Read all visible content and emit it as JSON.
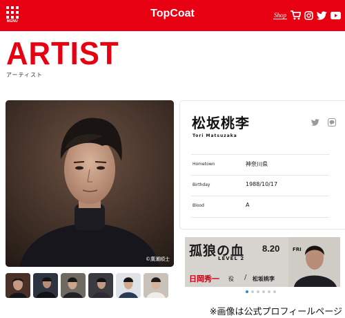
{
  "header": {
    "menu_label": "MENU",
    "brand": "TopCoat",
    "shop_logo_text": "Shop",
    "icons": [
      "shop-logo",
      "cart-icon",
      "instagram-icon",
      "twitter-icon",
      "youtube-icon"
    ]
  },
  "page": {
    "title": "ARTIST",
    "subtitle": "アーティスト"
  },
  "photo": {
    "credit": "©廣瀬順士"
  },
  "thumbnails": [
    "thumb-1",
    "thumb-2",
    "thumb-3",
    "thumb-4",
    "thumb-5",
    "thumb-6"
  ],
  "artist": {
    "name": "松坂桃李",
    "roman": "Tori Matsuzaka",
    "social": [
      "twitter-icon",
      "line-icon"
    ],
    "info": [
      {
        "label": "Hometown",
        "value": "神奈川県"
      },
      {
        "label": "Birthday",
        "value": "1988/10/17"
      },
      {
        "label": "Blood",
        "value": "A"
      }
    ]
  },
  "banner": {
    "title": "孤狼の血",
    "level": "LEVEL 2",
    "date": "8.20",
    "day": "FRI",
    "role": "日岡秀一",
    "role_suffix": "役",
    "slash": "/",
    "actor": "松坂桃李",
    "dots_total": 6,
    "dots_active": 1
  },
  "caption": "※画像は公式プロフィールページ",
  "colors": {
    "brand_red": "#e60012",
    "dot_active": "#2f87c8"
  }
}
